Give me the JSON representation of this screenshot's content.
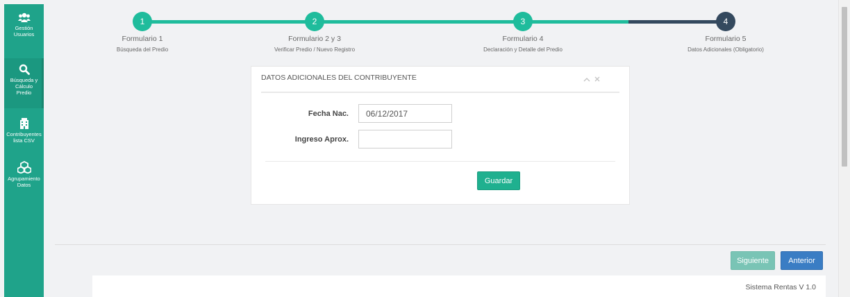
{
  "sidebar": {
    "items": [
      {
        "label_line1": "Gestión",
        "label_line2": "Usuarios",
        "icon": "users-icon"
      },
      {
        "label_line1": "Búsqueda y",
        "label_line2": "Cálculo",
        "label_line3": "Predio",
        "icon": "search-icon"
      },
      {
        "label_line1": "Contribuyentes",
        "label_line2": "lista CSV",
        "icon": "building-icon"
      },
      {
        "label_line1": "Agrupamiento",
        "label_line2": "Datos",
        "icon": "cubes-icon"
      }
    ]
  },
  "stepper": {
    "steps": [
      {
        "number": "1",
        "title": "Formulario 1",
        "subtitle": "Búsqueda del Predio",
        "state": "done"
      },
      {
        "number": "2",
        "title": "Formulario 2 y 3",
        "subtitle": "Verificar Predio / Nuevo Registro",
        "state": "done"
      },
      {
        "number": "3",
        "title": "Formulario 4",
        "subtitle": "Declaración y Detalle del Predio",
        "state": "done"
      },
      {
        "number": "4",
        "title": "Formulario 5",
        "subtitle": "Datos Adicionales (Obligatorio)",
        "state": "current"
      }
    ]
  },
  "panel": {
    "title": "DATOS ADICIONALES DEL CONTRIBUYENTE",
    "collapse_icon": "chevron-up-icon",
    "close_icon": "close-icon",
    "fields": {
      "fecha_label": "Fecha Nac.",
      "fecha_value": "06/12/2017",
      "ingreso_label": "Ingreso Aprox.",
      "ingreso_value": ""
    },
    "save_label": "Guardar"
  },
  "nav": {
    "next_label": "Siguiente",
    "prev_label": "Anterior"
  },
  "footer": {
    "text": "Sistema Rentas V 1.0"
  },
  "colors": {
    "sidebar": "#1fa38a",
    "step_done": "#1fbc9c",
    "step_current": "#34495e",
    "save_button": "#1fb08f",
    "next_button": "#79c4b5",
    "prev_button": "#3a7dc4"
  }
}
